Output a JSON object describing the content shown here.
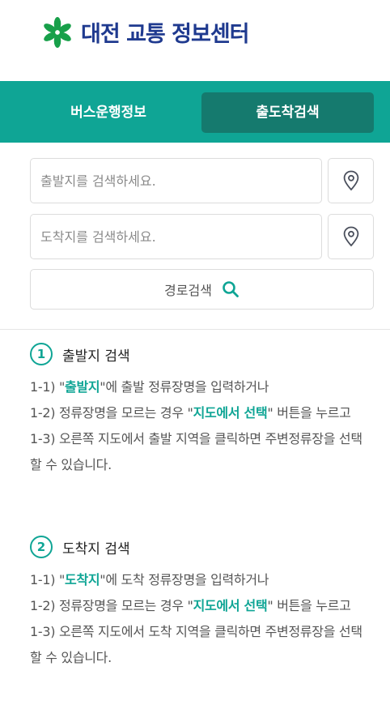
{
  "header": {
    "title": "대전 교통 정보센터",
    "brand_color": "#1f3a8f",
    "mark_color": "#18a04a"
  },
  "tabs": [
    {
      "label": "버스운행정보",
      "active": false
    },
    {
      "label": "출도착검색",
      "active": true
    }
  ],
  "search": {
    "origin_placeholder": "출발지를 검색하세요.",
    "dest_placeholder": "도착지를 검색하세요.",
    "route_button": "경로검색"
  },
  "guides": [
    {
      "number": "1",
      "title": "출발지 검색",
      "s1_pre": "1-1) \"",
      "s1_hl": "출발지",
      "s1_post": "\"에 출발 정류장명을 입력하거나",
      "s2_pre": "1-2) 정류장명을 모르는 경우 \"",
      "s2_hl": "지도에서 선택",
      "s2_post": "\" 버튼을 누르고",
      "s3": "1-3) 오른쪽 지도에서 출발 지역을 클릭하면 주변정류장을 선택할 수 있습니다."
    },
    {
      "number": "2",
      "title": "도착지 검색",
      "s1_pre": "1-1) \"",
      "s1_hl": "도착지",
      "s1_post": "\"에 도착 정류장명을 입력하거나",
      "s2_pre": "1-2) 정류장명을 모르는 경우 \"",
      "s2_hl": "지도에서 선택",
      "s2_post": "\" 버튼을 누르고",
      "s3": "1-3) 오른쪽 지도에서 도착 지역을 클릭하면 주변정류장을 선택할 수 있습니다."
    }
  ],
  "colors": {
    "accent": "#0fa595",
    "active_tab": "#157a6e"
  }
}
